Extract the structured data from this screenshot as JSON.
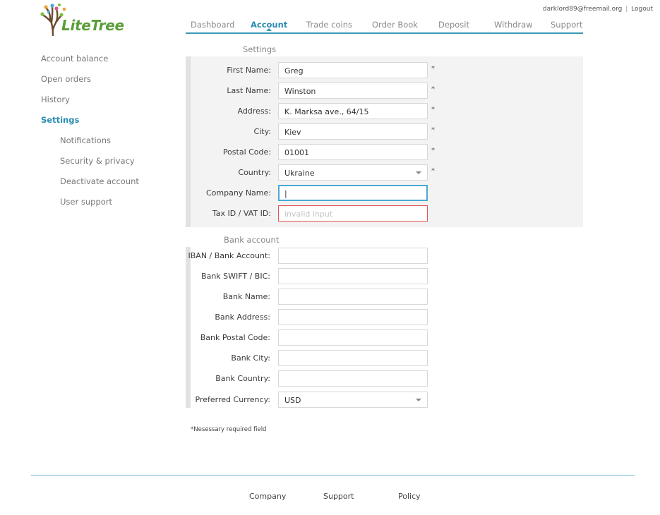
{
  "header": {
    "user_email": "darklord89@freemail.org",
    "separator": "|",
    "logout_label": "Logout",
    "logo_text": "LiteTree"
  },
  "topnav": {
    "tabs": [
      {
        "label": "Dashboard",
        "active": false
      },
      {
        "label": "Account",
        "active": true
      },
      {
        "label": "Trade coins",
        "active": false
      },
      {
        "label": "Order Book",
        "active": false
      },
      {
        "label": "Deposit",
        "active": false
      },
      {
        "label": "Withdraw",
        "active": false
      },
      {
        "label": "Support",
        "active": false
      }
    ]
  },
  "sidebar": {
    "items": [
      {
        "label": "Account balance"
      },
      {
        "label": "Open orders"
      },
      {
        "label": "History"
      },
      {
        "label": "Settings",
        "active": true
      },
      {
        "label": "Notifications"
      },
      {
        "label": "Security & privacy"
      },
      {
        "label": "Deactivate account"
      },
      {
        "label": "User support"
      }
    ]
  },
  "settings": {
    "title": "Settings",
    "fields": [
      {
        "label": "First Name:",
        "value": "Greg",
        "required": "*"
      },
      {
        "label": "Last Name:",
        "value": "Winston",
        "required": "*"
      },
      {
        "label": "Address:",
        "value": "K. Marksa ave., 64/15",
        "required": "*"
      },
      {
        "label": "City:",
        "value": "Kiev",
        "required": "*"
      },
      {
        "label": "Postal Code:",
        "value": "01001",
        "required": "*"
      },
      {
        "label": "Country:",
        "value": "Ukraine",
        "required": "*"
      },
      {
        "label": "Company Name:",
        "value": "|"
      },
      {
        "label": "Tax ID / VAT ID:",
        "placeholder": "invalid input"
      }
    ]
  },
  "bank": {
    "title": "Bank account",
    "fields": [
      {
        "label": "IBAN / Bank Account:",
        "value": ""
      },
      {
        "label": "Bank SWIFT / BIC:",
        "value": ""
      },
      {
        "label": "Bank Name:",
        "value": ""
      },
      {
        "label": "Bank Address:",
        "value": ""
      },
      {
        "label": "Bank Postal Code:",
        "value": ""
      },
      {
        "label": "Bank City:",
        "value": ""
      },
      {
        "label": "Bank Country:",
        "value": ""
      },
      {
        "label": "Preferred Currency:",
        "value": "USD"
      }
    ]
  },
  "note": "*Nesessary required field",
  "footer": {
    "links": [
      "Company",
      "Support",
      "Policy"
    ]
  },
  "colors": {
    "accent": "#2b8db2",
    "logo_green": "#5a9e3a",
    "error": "#e05555",
    "focus": "#4aa9d2"
  }
}
